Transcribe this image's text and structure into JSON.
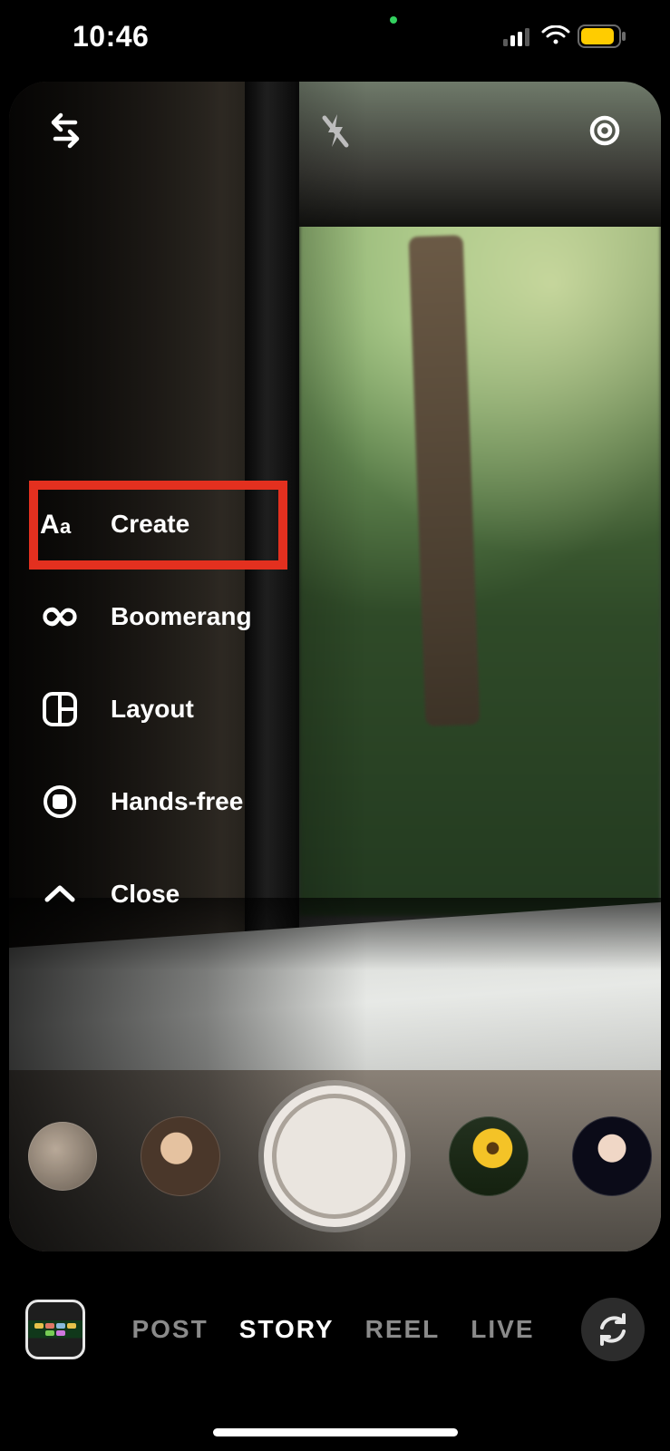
{
  "status": {
    "time": "10:46"
  },
  "tools": {
    "create": "Create",
    "boomerang": "Boomerang",
    "layout": "Layout",
    "handsfree": "Hands-free",
    "close": "Close"
  },
  "modes": {
    "post": "POST",
    "story": "STORY",
    "reel": "REEL",
    "live": "LIVE"
  }
}
